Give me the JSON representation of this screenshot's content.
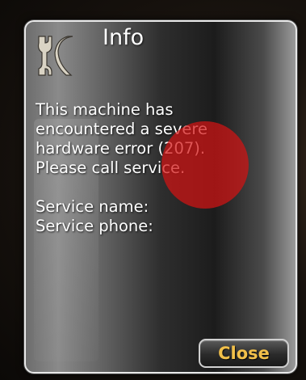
{
  "dialog": {
    "title": "Info",
    "icon": "wrench-icon",
    "message_lines": [
      "This machine has",
      "encountered a severe",
      "hardware error (207).",
      "Please call service."
    ],
    "service_name_label": "Service name:",
    "service_phone_label": "Service phone:",
    "close_label": "Close"
  },
  "colors": {
    "close_text": "#f2c04a",
    "touch_marker": "#d21414",
    "text": "#ffffff"
  }
}
